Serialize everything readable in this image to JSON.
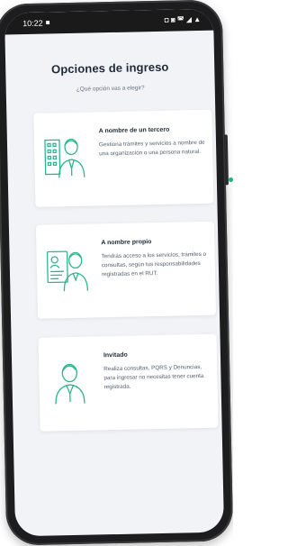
{
  "status_bar": {
    "time": "10:22",
    "indicators": "◘ ◙ ◚ ◢ ▲"
  },
  "screen": {
    "title": "Opciones de ingreso",
    "subtitle": "¿Qué opción vas a elegir?"
  },
  "options": [
    {
      "title": "A nombre de un tercero",
      "description": "Gestiona trámites y servicios a nombre de una organización o una persona natural.",
      "icon": "business-person-icon"
    },
    {
      "title": "A nombre propio",
      "description": "Tendrás acceso a los servicios, trámites o consultas, según tus responsabilidades registradas en el RUT.",
      "icon": "person-id-document-icon"
    },
    {
      "title": "Invitado",
      "description": "Realiza consultas, PQRS y Denuncias, para ingresar no necesitas tener cuenta registrada.",
      "icon": "guest-person-icon"
    }
  ],
  "colors": {
    "accent": "#2fb58e",
    "indicator_dot": "#18b67a",
    "phone_frame": "#1d1d1f",
    "screen_bg": "#f2f3f6"
  }
}
